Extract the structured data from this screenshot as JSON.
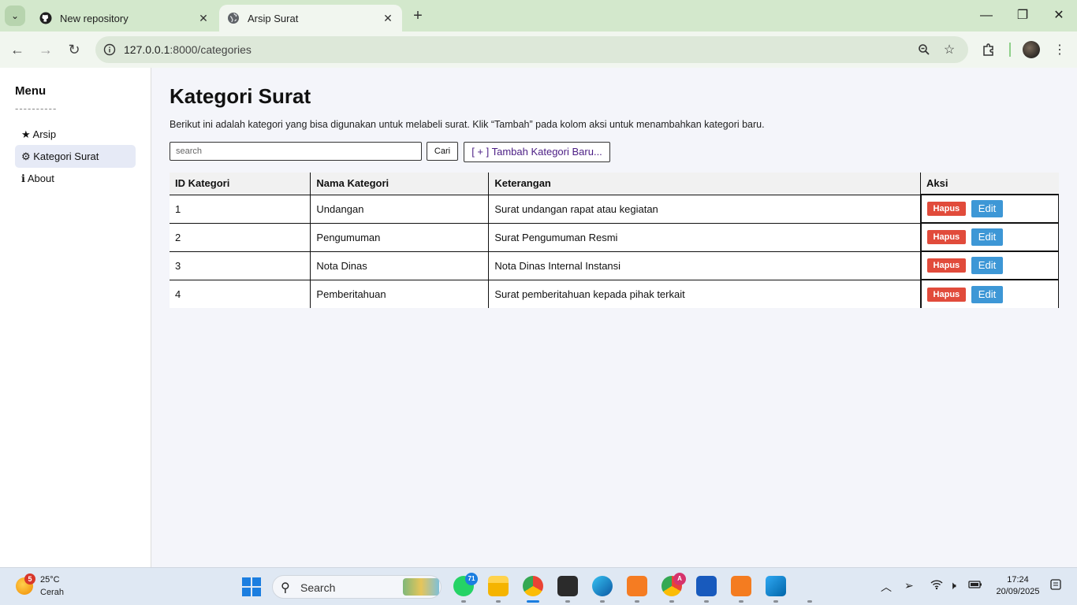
{
  "browser": {
    "tabs": [
      {
        "title": "New repository",
        "icon": "github-icon"
      },
      {
        "title": "Arsip Surat",
        "icon": "globe-icon"
      }
    ],
    "url_host": "127.0.0.1",
    "url_path": ":8000/categories"
  },
  "sidebar": {
    "title": "Menu",
    "dashes": "----------",
    "items": [
      {
        "label": "★ Arsip"
      },
      {
        "label": "⚙ Kategori Surat"
      },
      {
        "label": "ℹ About"
      }
    ]
  },
  "main": {
    "title": "Kategori Surat",
    "description": "Berikut ini adalah kategori yang bisa digunakan untuk melabeli surat. Klik “Tambah” pada kolom aksi untuk menambahkan kategori baru.",
    "search_placeholder": "search",
    "search_button": "Cari",
    "add_button": "[ + ] Tambah Kategori Baru...",
    "table": {
      "headers": [
        "ID Kategori",
        "Nama Kategori",
        "Keterangan",
        "Aksi"
      ],
      "rows": [
        {
          "id": "1",
          "nama": "Undangan",
          "keterangan": "Surat undangan rapat atau kegiatan"
        },
        {
          "id": "2",
          "nama": "Pengumuman",
          "keterangan": "Surat Pengumuman Resmi"
        },
        {
          "id": "3",
          "nama": "Nota Dinas",
          "keterangan": "Nota Dinas Internal Instansi"
        },
        {
          "id": "4",
          "nama": "Pemberitahuan",
          "keterangan": "Surat pemberitahuan kepada pihak terkait"
        }
      ],
      "delete_label": "Hapus",
      "edit_label": "Edit"
    }
  },
  "taskbar": {
    "weather_badge": "5",
    "weather_temp": "25°C",
    "weather_cond": "Cerah",
    "search_label": "Search",
    "whatsapp_badge": "71",
    "chrome_badge": "A",
    "time": "17:24",
    "date": "20/09/2025"
  },
  "colors": {
    "delete": "#e14b3b",
    "edit": "#3d97d6",
    "add_text": "#4b1d84"
  }
}
